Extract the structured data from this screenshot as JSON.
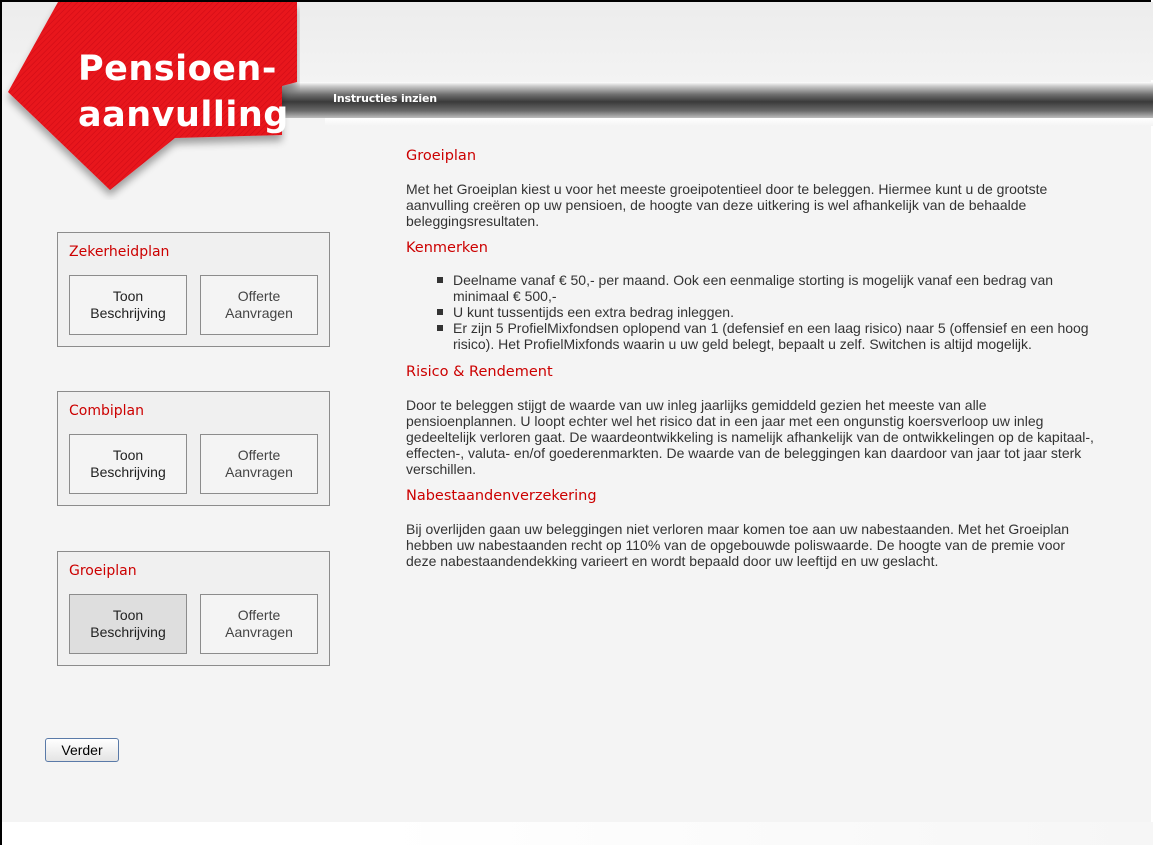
{
  "logo": {
    "line1": "Pensioen-",
    "line2": "aanvulling"
  },
  "header": {
    "instructions_link": "Instructies inzien"
  },
  "plans": [
    {
      "title": "Zekerheidplan",
      "describe_label": "Toon Beschrijving",
      "quote_label": "Offerte Aanvragen",
      "active": false
    },
    {
      "title": "Combiplan",
      "describe_label": "Toon Beschrijving",
      "quote_label": "Offerte Aanvragen",
      "active": false
    },
    {
      "title": "Groeiplan",
      "describe_label": "Toon Beschrijving",
      "quote_label": "Offerte Aanvragen",
      "active": true
    }
  ],
  "next_button": "Verder",
  "content": {
    "title": "Groeiplan",
    "intro": "Met het Groeiplan kiest u voor het meeste groeipotentieel door te beleggen. Hiermee kunt u de grootste aanvulling creëren op uw pensioen, de hoogte van deze uitkering is wel afhankelijk van de behaalde beleggingsresultaten.",
    "features_title": "Kenmerken",
    "features": [
      "Deelname vanaf € 50,- per maand. Ook een eenmalige storting is mogelijk vanaf een bedrag van minimaal € 500,-",
      "U kunt tussentijds een extra bedrag inleggen.",
      "Er zijn 5 ProfielMixfondsen oplopend van 1 (defensief en een laag risico) naar 5 (offensief en een hoog risico). Het ProfielMixfonds waarin u uw geld belegt, bepaalt u zelf. Switchen is altijd mogelijk."
    ],
    "risk_title": "Risico & Rendement",
    "risk_text": "Door te beleggen stijgt de waarde van uw inleg jaarlijks gemiddeld gezien het meeste van alle pensioenplannen. U loopt echter wel het risico dat in een jaar met een ongunstig koersverloop uw inleg gedeeltelijk verloren gaat. De waardeontwikkeling is namelijk afhankelijk van de ontwikkelingen op de kapitaal-, effecten-, valuta- en/of goederenmarkten. De waarde van de beleggingen kan daardoor van jaar tot jaar sterk verschillen.",
    "survivor_title": "Nabestaandenverzekering",
    "survivor_text": "Bij overlijden gaan uw beleggingen niet verloren maar komen toe aan uw nabestaanden. Met het Groeiplan hebben uw nabestaanden recht op 110% van de opgebouwde poliswaarde. De hoogte van de premie voor deze nabestaandendekking varieert en wordt bepaald door uw leeftijd en uw geslacht."
  },
  "colors": {
    "accent": "#cc0000",
    "logo_red": "#e8141e"
  }
}
